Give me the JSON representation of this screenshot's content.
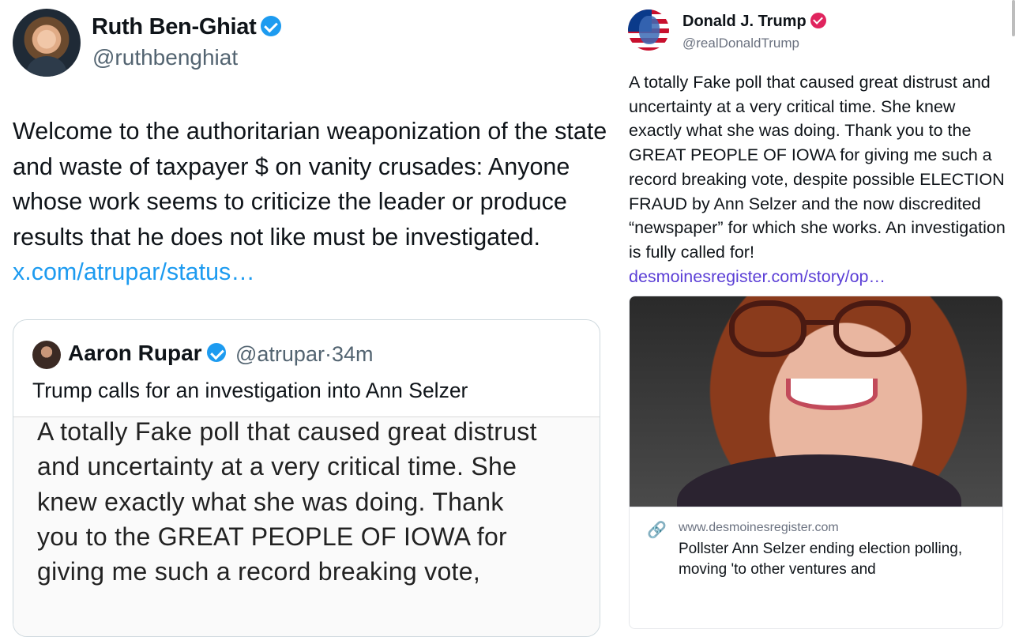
{
  "left_tweet": {
    "author_name": "Ruth Ben-Ghiat",
    "handle": "@ruthbenghiat",
    "text": "Welcome to the authoritarian weaponization of the state and waste of taxpayer $ on vanity crusades: Anyone whose work seems to criticize the leader or produce results that he does not like must be investigated.",
    "link": "x.com/atrupar/status…",
    "quoted": {
      "author_name": "Aaron Rupar",
      "handle": "@atrupar",
      "time": "·34m",
      "text": "Trump calls for an investigation into Ann Selzer",
      "embedded_lines": [
        "A totally Fake poll that caused great distrust",
        "and uncertainty at a very critical time. She",
        "knew exactly what she was doing. Thank",
        "you to the GREAT PEOPLE OF IOWA for",
        "giving me such a record breaking vote,"
      ]
    }
  },
  "right_post": {
    "author_name": "Donald J. Trump",
    "handle": "@realDonaldTrump",
    "text": "A totally Fake poll that caused great distrust and uncertainty at a very critical time. She knew exactly what she was doing. Thank you to the GREAT PEOPLE OF IOWA for giving me such a record breaking vote, despite possible ELECTION FRAUD by Ann Selzer and the now discredited “newspaper” for which she works. An investigation is fully called for!",
    "link": "desmoinesregister.com/story/op…",
    "card": {
      "domain": "www.desmoinesregister.com",
      "title": "Pollster Ann Selzer ending election polling, moving 'to other ventures and"
    }
  },
  "colors": {
    "x_blue": "#1d9bf0",
    "truth_link_purple": "#5b3fd6",
    "truth_badge_pink": "#e0245e",
    "text": "#0f1419",
    "muted": "#536471"
  },
  "icons": [
    "verified-badge-icon",
    "link-icon"
  ]
}
